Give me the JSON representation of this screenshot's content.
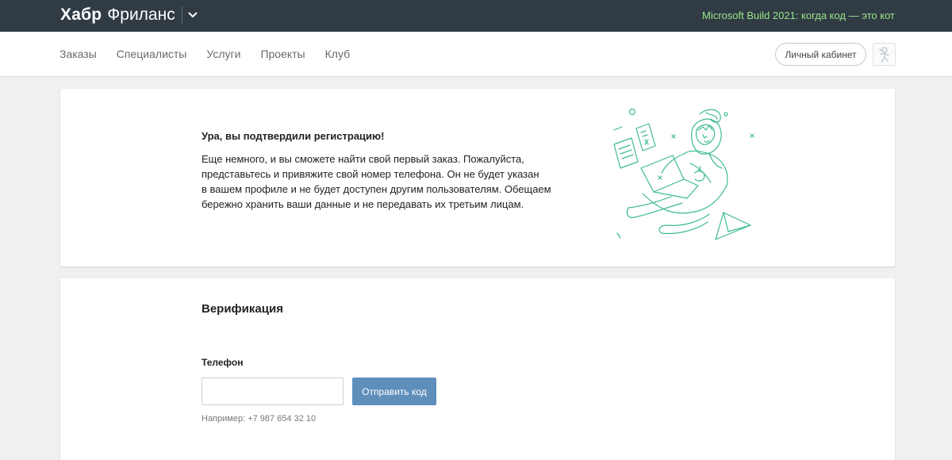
{
  "header": {
    "brand": "Хабр",
    "product": "Фриланс",
    "toggle_icon": "chevron-down-icon",
    "promo": "Microsoft Build 2021: когда код — это кот",
    "promo_color": "#9be58a",
    "background": "#303b44"
  },
  "nav": {
    "links": [
      "Заказы",
      "Специалисты",
      "Услуги",
      "Проекты",
      "Клуб"
    ],
    "cabinet_button": "Личный кабинет",
    "avatar_icon": "user-avatar-icon"
  },
  "welcome": {
    "title": "Ура, вы подтвердили регистрацию!",
    "body_lines": [
      "Еще немного, и вы сможете найти свой первый заказ. Пожалуйста,",
      "представьтесь и привяжите свой номер телефона. Он не будет указан",
      "в вашем профиле и не будет доступен другим пользователям. Обещаем",
      "бережно хранить ваши данные и не передавать их третьим лицам."
    ],
    "illustration_icon": "astronaut-freelancer-illustration",
    "illustration_color": "#3dbb8c"
  },
  "verification": {
    "title": "Верификация",
    "phone_label": "Телефон",
    "phone_value": "",
    "phone_placeholder": "",
    "send_button": "Отправить код",
    "button_color": "#5e8fbb",
    "hint": "Например: +7 987 654 32 10"
  }
}
